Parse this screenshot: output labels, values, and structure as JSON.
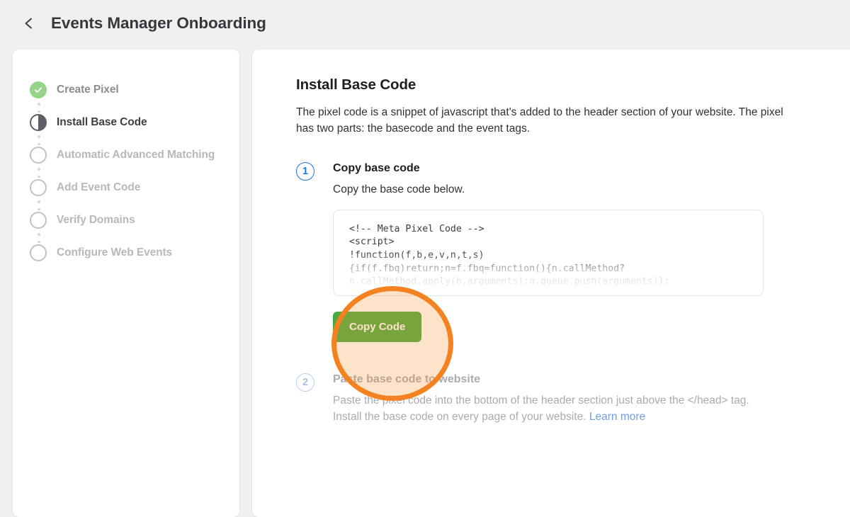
{
  "header": {
    "back_icon": "chevron-left-icon",
    "title": "Events Manager Onboarding"
  },
  "sidebar": {
    "steps": [
      {
        "label": "Create Pixel",
        "state": "done",
        "icon": "check-circle-icon"
      },
      {
        "label": "Install Base Code",
        "state": "current",
        "icon": "half-circle-icon"
      },
      {
        "label": "Automatic Advanced Matching",
        "state": "pending",
        "icon": "empty-circle-icon"
      },
      {
        "label": "Add Event Code",
        "state": "pending",
        "icon": "empty-circle-icon"
      },
      {
        "label": "Verify Domains",
        "state": "pending",
        "icon": "empty-circle-icon"
      },
      {
        "label": "Configure Web Events",
        "state": "pending",
        "icon": "empty-circle-icon"
      }
    ]
  },
  "main": {
    "title": "Install Base Code",
    "description": "The pixel code is a snippet of javascript that's added to the header section of your website. The pixel has two parts: the basecode and the event tags.",
    "step1": {
      "number": "1",
      "title": "Copy base code",
      "text": "Copy the base code below.",
      "code": "<!-- Meta Pixel Code -->\n<script>\n!function(f,b,e,v,n,t,s)\n{if(f.fbq)return;n=f.fbq=function(){n.callMethod?\nn.callMethod.apply(n,arguments):n.queue.push(arguments)};",
      "copy_button": "Copy Code"
    },
    "step2": {
      "number": "2",
      "title": "Paste base code to website",
      "text": "Paste the pixel code into the bottom of the header section just above the </head> tag. Install the base code on every page of your website. ",
      "link": "Learn more"
    }
  },
  "annotation": {
    "shape": "circle-highlight",
    "color": "#f58220",
    "fill": "rgba(245,150,60,0.27)"
  },
  "colors": {
    "page_background": "#f0f0f0",
    "card_background": "#ffffff",
    "accent_blue": "#1877f2",
    "success_green": "#96d48a",
    "button_green": "#4aa93f",
    "highlight_orange": "#f58220"
  }
}
